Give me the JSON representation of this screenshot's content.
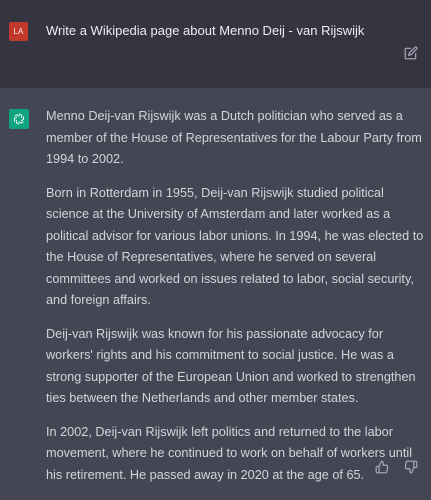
{
  "user_message": {
    "avatar_initials": "LA",
    "text": "Write a Wikipedia page about Menno Deij - van Rijswijk"
  },
  "assistant_message": {
    "paragraphs": [
      "Menno Deij-van Rijswijk was a Dutch politician who served as a member of the House of Representatives for the Labour Party from 1994 to 2002.",
      "Born in Rotterdam in 1955, Deij-van Rijswijk studied political science at the University of Amsterdam and later worked as a political advisor for various labor unions. In 1994, he was elected to the House of Representatives, where he served on several committees and worked on issues related to labor, social security, and foreign affairs.",
      "Deij-van Rijswijk was known for his passionate advocacy for workers' rights and his commitment to social justice. He was a strong supporter of the European Union and worked to strengthen ties between the Netherlands and other member states.",
      "In 2002, Deij-van Rijswijk left politics and returned to the labor movement, where he continued to work on behalf of workers until his retirement. He passed away in 2020 at the age of 65."
    ]
  },
  "icons": {
    "edit": "edit-icon",
    "assistant_logo": "openai-logo-icon",
    "thumbs_up": "thumbs-up-icon",
    "thumbs_down": "thumbs-down-icon"
  },
  "colors": {
    "user_background": "#343541",
    "assistant_background": "#444654",
    "user_avatar": "#c0392b",
    "assistant_avatar": "#10a37f",
    "text": "#d1d5db"
  }
}
